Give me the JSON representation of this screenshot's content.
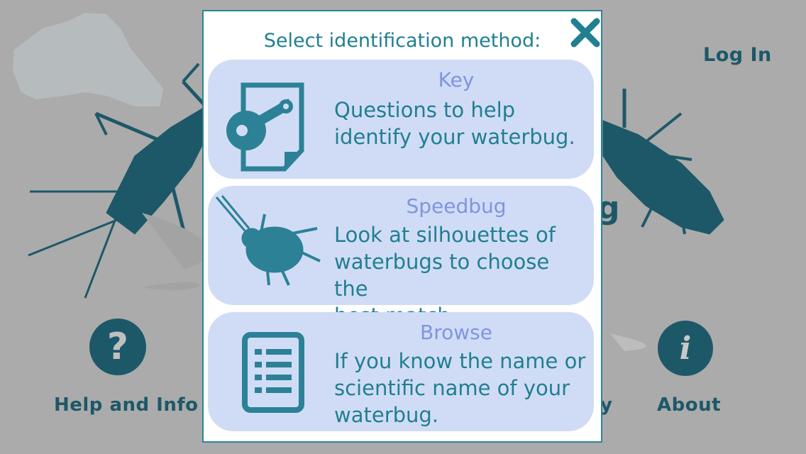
{
  "header": {
    "login_label": "Log In"
  },
  "bottom_nav": {
    "help_label": "Help and Info",
    "about_label": "About",
    "partial_label": "y"
  },
  "background": {
    "partial_logo_text": "g"
  },
  "modal": {
    "title": "Select identification method:",
    "close_icon": "close-icon",
    "options": [
      {
        "title": "Key",
        "description_lines": [
          "Questions to help",
          "identify your waterbug."
        ],
        "icon": "key-document-icon"
      },
      {
        "title": "Speedbug",
        "description_lines": [
          "Look at silhouettes of",
          "waterbugs to choose the",
          "best match."
        ],
        "icon": "bug-silhouette-icon"
      },
      {
        "title": "Browse",
        "description_lines": [
          "If you know the name or",
          "scientific name of your",
          "waterbug."
        ],
        "icon": "list-document-icon"
      }
    ]
  },
  "colors": {
    "accent": "#217f91",
    "card_bg": "#d0dcf5",
    "card_title": "#7f95e0",
    "background": "#ababab",
    "dark_teal": "#1d5868"
  }
}
